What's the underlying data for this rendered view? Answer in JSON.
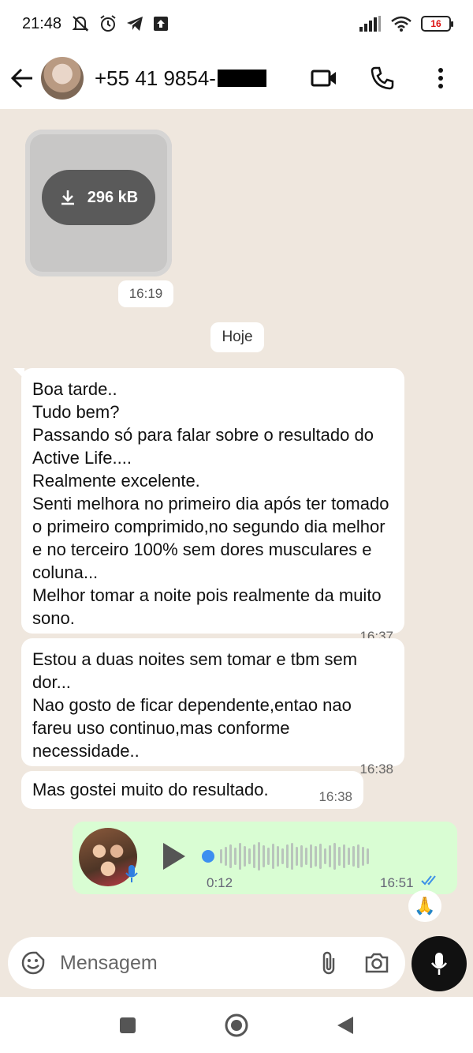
{
  "status_bar": {
    "time": "21:48",
    "battery": "16",
    "icons": [
      "mute-icon",
      "alarm-icon",
      "telegram-icon",
      "upload-icon",
      "signal-icon",
      "wifi-icon",
      "battery-icon"
    ]
  },
  "header": {
    "contact_name": "+55 41 9854-",
    "icons": [
      "back-arrow-icon",
      "video-call-icon",
      "phone-icon",
      "more-vert-icon"
    ]
  },
  "chat": {
    "media": {
      "size_label": "296 kB",
      "time": "16:19"
    },
    "date_divider": "Hoje",
    "messages": [
      {
        "text": "Boa tarde..\nTudo bem?\nPassando só para falar sobre o resultado do Active Life....\nRealmente excelente.\nSenti melhora no primeiro dia após ter tomado o primeiro comprimido,no segundo dia melhor e no terceiro 100% sem dores musculares e coluna...\nMelhor tomar a noite pois realmente da muito sono.",
        "time": "16:37"
      },
      {
        "text": "Estou a duas noites sem tomar e tbm sem dor...\nNao gosto de ficar dependente,entao nao fareu uso continuo,mas conforme necessidade..",
        "time": "16:38"
      },
      {
        "text": "Mas gostei muito do resultado.",
        "time": "16:38"
      }
    ],
    "voice_message": {
      "duration": "0:12",
      "time": "16:51",
      "status": "read"
    },
    "reaction": "🙏"
  },
  "input": {
    "placeholder": "Mensagem",
    "icons": [
      "emoji-icon",
      "attach-icon",
      "camera-icon",
      "mic-icon"
    ]
  },
  "nav_bar": {
    "icons": [
      "recents-icon",
      "home-icon",
      "back-icon"
    ]
  }
}
